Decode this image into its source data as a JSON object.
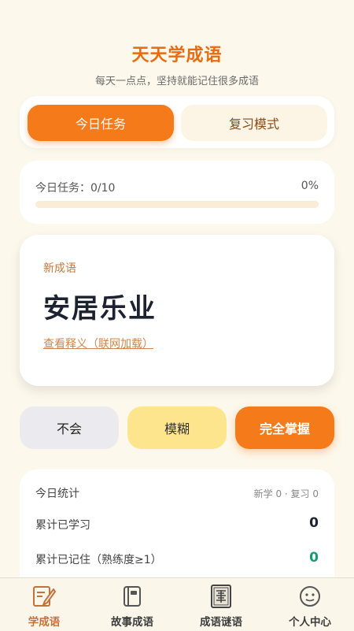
{
  "header": {
    "title": "天天学成语",
    "subtitle": "每天一点点，坚持就能记住很多成语"
  },
  "modes": {
    "today_task": "今日任务",
    "review_mode": "复习模式",
    "active": "today_task"
  },
  "progress": {
    "label": "今日任务：0/10",
    "percent_text": "0%",
    "fraction": 0
  },
  "card": {
    "tag": "新成语",
    "idiom": "安居乐业",
    "meaning_link": "查看释义（联网加载）"
  },
  "answers": {
    "dont_know": "不会",
    "fuzzy": "模糊",
    "mastered": "完全掌握"
  },
  "stats": {
    "title": "今日统计",
    "summary": "新学 0 · 复习 0",
    "rows": [
      {
        "label": "累计已学习",
        "value": "0"
      },
      {
        "label": "累计已记住（熟练度≥1）",
        "value": "0"
      }
    ]
  },
  "tabs": [
    {
      "label": "学成语",
      "icon": "pencil-note-icon"
    },
    {
      "label": "故事成语",
      "icon": "book-icon"
    },
    {
      "label": "成语谜语",
      "icon": "riddle-seal-icon"
    },
    {
      "label": "个人中心",
      "icon": "smiley-face-icon"
    }
  ],
  "colors": {
    "accent": "#f47a1a",
    "background": "#fdf8ec",
    "value_black": "#1c2230",
    "value_green": "#1a9a73"
  }
}
